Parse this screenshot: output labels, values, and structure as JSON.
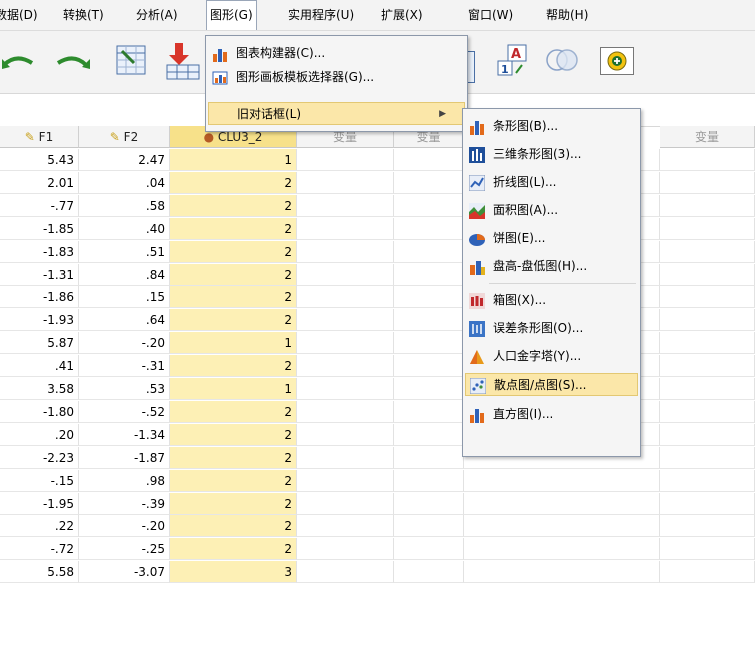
{
  "menubar": {
    "items": [
      {
        "label": "数据(D)"
      },
      {
        "label": "转换(T)"
      },
      {
        "label": "分析(A)"
      },
      {
        "label": "图形(G)"
      },
      {
        "label": "实用程序(U)"
      },
      {
        "label": "扩展(X)"
      },
      {
        "label": "窗口(W)"
      },
      {
        "label": "帮助(H)"
      }
    ]
  },
  "graphs_menu": {
    "items": [
      {
        "label": "图表构建器(C)..."
      },
      {
        "label": "图形画板模板选择器(G)..."
      },
      {
        "label": "旧对话框(L)"
      }
    ]
  },
  "legacy_menu": {
    "items": [
      {
        "label": "条形图(B)..."
      },
      {
        "label": "三维条形图(3)..."
      },
      {
        "label": "折线图(L)..."
      },
      {
        "label": "面积图(A)..."
      },
      {
        "label": "饼图(E)..."
      },
      {
        "label": "盘高-盘低图(H)..."
      },
      {
        "label": "箱图(X)..."
      },
      {
        "label": "误差条形图(O)..."
      },
      {
        "label": "人口金字塔(Y)..."
      },
      {
        "label": "散点图/点图(S)..."
      },
      {
        "label": "直方图(I)..."
      }
    ]
  },
  "grid": {
    "columns": [
      "F1",
      "F2",
      "CLU3_2",
      "变量",
      "变量",
      "变量"
    ],
    "rows": [
      [
        "5.43",
        "2.47",
        "1"
      ],
      [
        "2.01",
        ".04",
        "2"
      ],
      [
        "-.77",
        ".58",
        "2"
      ],
      [
        "-1.85",
        ".40",
        "2"
      ],
      [
        "-1.83",
        ".51",
        "2"
      ],
      [
        "-1.31",
        ".84",
        "2"
      ],
      [
        "-1.86",
        ".15",
        "2"
      ],
      [
        "-1.93",
        ".64",
        "2"
      ],
      [
        "5.87",
        "-.20",
        "1"
      ],
      [
        ".41",
        "-.31",
        "2"
      ],
      [
        "3.58",
        ".53",
        "1"
      ],
      [
        "-1.80",
        "-.52",
        "2"
      ],
      [
        ".20",
        "-1.34",
        "2"
      ],
      [
        "-2.23",
        "-1.87",
        "2"
      ],
      [
        "-.15",
        ".98",
        "2"
      ],
      [
        "-1.95",
        "-.39",
        "2"
      ],
      [
        ".22",
        "-.20",
        "2"
      ],
      [
        "-.72",
        "-.25",
        "2"
      ],
      [
        "5.58",
        "-3.07",
        "3"
      ]
    ]
  },
  "colors": {
    "selected_column": "#fdf0b5",
    "menu_highlight": "#fbe7a9"
  }
}
